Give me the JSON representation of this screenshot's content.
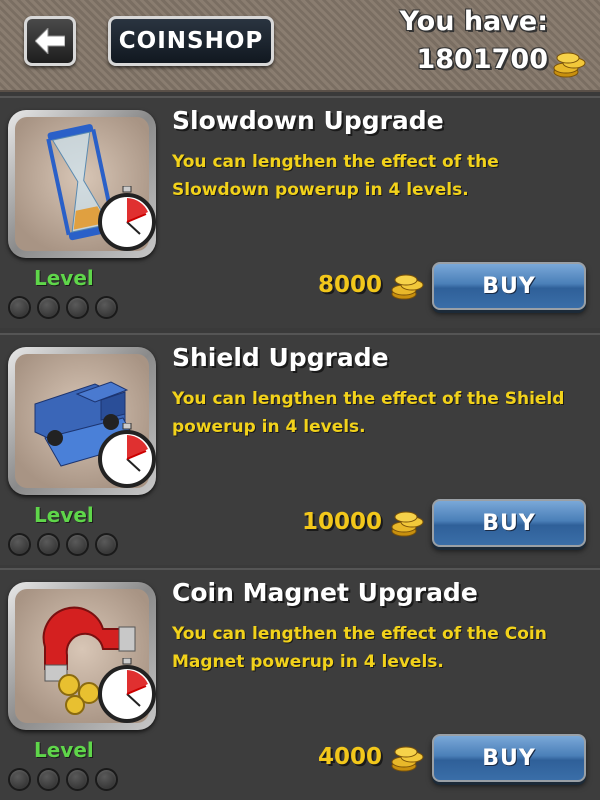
{
  "header": {
    "title": "COINSHOP",
    "you_have_label": "You have:",
    "balance": "1801700",
    "back_icon": "back-arrow-icon",
    "coin_icon": "coin-stack-icon"
  },
  "items": [
    {
      "title": "Slowdown Upgrade",
      "description": "You can lengthen the effect of the Slowdown powerup in 4 levels.",
      "icon": "hourglass-icon",
      "level_label": "Level",
      "levels_total": 4,
      "levels_filled": 0,
      "price": "8000",
      "buy_label": "BUY"
    },
    {
      "title": "Shield Upgrade",
      "description": "You can lengthen the effect of the Shield powerup in 4 levels.",
      "icon": "snowplow-truck-icon",
      "level_label": "Level",
      "levels_total": 4,
      "levels_filled": 0,
      "price": "10000",
      "buy_label": "BUY"
    },
    {
      "title": "Coin Magnet Upgrade",
      "description": "You can lengthen the effect of the Coin Magnet powerup in 4 levels.",
      "icon": "magnet-icon",
      "level_label": "Level",
      "levels_total": 4,
      "levels_filled": 0,
      "price": "4000",
      "buy_label": "BUY"
    }
  ],
  "colors": {
    "title_text": "#ffffff",
    "description_text": "#f2d21b",
    "price_text": "#f2c71b",
    "level_text": "#5fd64a",
    "buy_button": "#3a6ea8"
  }
}
